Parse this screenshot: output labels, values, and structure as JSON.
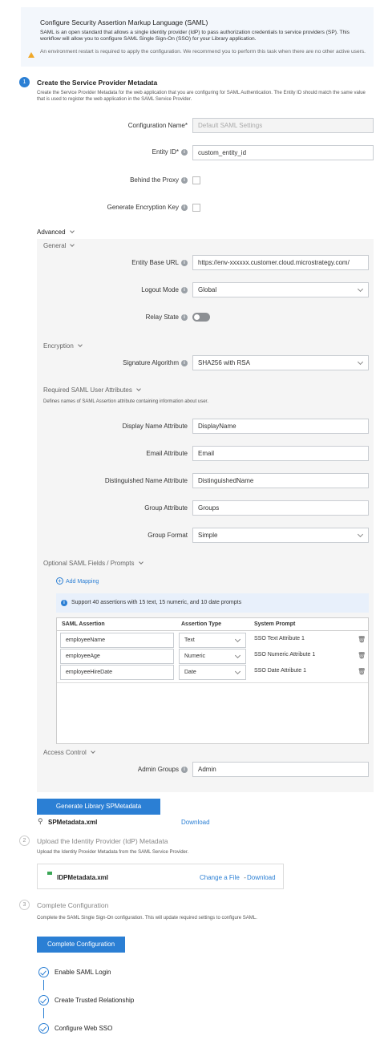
{
  "banner": {
    "title": "Configure Security Assertion Markup Language (SAML)",
    "description": "SAML is an open standard that allows a single identity provider (IdP) to pass authorization credentials to service providers (SP). This workflow will allow you to configure SAML Single Sign-On (SSO) for your Library application.",
    "warning": "An environment restart is required to apply the configuration. We recommend you to perform this task when there are no other active users."
  },
  "step1": {
    "number": "1",
    "title": "Create the Service Provider Metadata",
    "description": "Create the Service Provider Metadata for the web application that you are configuring for SAML Authentication. The Entity ID should match the same value that is used to register the web application in the SAML Service Provider.",
    "config_name": {
      "label": "Configuration Name*",
      "placeholder": "Default SAML Settings"
    },
    "entity_id": {
      "label": "Entity ID*",
      "value": "custom_entity_id"
    },
    "behind_proxy": {
      "label": "Behind the Proxy"
    },
    "gen_enc_key": {
      "label": "Generate Encryption Key"
    },
    "advanced_label": "Advanced",
    "general": {
      "label": "General",
      "entity_base_url": {
        "label": "Entity Base URL",
        "value": "https://env-xxxxxx.customer.cloud.microstrategy.com/"
      },
      "logout_mode": {
        "label": "Logout Mode",
        "value": "Global"
      },
      "relay_state": {
        "label": "Relay State"
      }
    },
    "encryption": {
      "label": "Encryption",
      "signature_algorithm": {
        "label": "Signature Algorithm",
        "value": "SHA256 with RSA"
      }
    },
    "required_attrs": {
      "label": "Required SAML User Attributes",
      "description": "Defines names of SAML Assertion attribute containing information about user.",
      "display_name": {
        "label": "Display Name Attribute",
        "value": "DisplayName"
      },
      "email": {
        "label": "Email Attribute",
        "value": "Email"
      },
      "distinguished_name": {
        "label": "Distinguished Name Attribute",
        "value": "DistinguishedName"
      },
      "group": {
        "label": "Group Attribute",
        "value": "Groups"
      },
      "group_format": {
        "label": "Group Format",
        "value": "Simple"
      }
    },
    "optional": {
      "label": "Optional SAML Fields / Prompts",
      "add_mapping": "Add Mapping",
      "note": "Support 40 assertions with 15 text, 15 numeric, and 10 date prompts",
      "headers": [
        "SAML Assertion",
        "Assertion Type",
        "System Prompt"
      ],
      "rows": [
        {
          "assertion": "employeeName",
          "type": "Text",
          "prompt": "SSO Text Attribute 1"
        },
        {
          "assertion": "employeeAge",
          "type": "Numeric",
          "prompt": "SSO Numeric Attribute 1"
        },
        {
          "assertion": "employeeHireDate",
          "type": "Date",
          "prompt": "SSO Date Attribute 1"
        }
      ]
    },
    "access_control": {
      "label": "Access Control",
      "admin_groups": {
        "label": "Admin Groups",
        "value": "Admin"
      }
    },
    "generate_button": "Generate Library SPMetadata",
    "file_name": "SPMetadata.xml",
    "download": "Download"
  },
  "step2": {
    "number": "2",
    "title": "Upload the Identity Provider (IdP) Metadata",
    "description": "Upload the Identity Provider Metadata from the SAML Service Provider.",
    "file_name": "IDPMetadata.xml",
    "change_file": "Change a File",
    "separator": " - ",
    "download": "Download"
  },
  "step3": {
    "number": "3",
    "title": "Complete Configuration",
    "description": "Complete the SAML Single Sign-On configuration. This will update required settings to configure SAML.",
    "button": "Complete Configuration",
    "checklist": [
      "Enable SAML Login",
      "Create Trusted Relationship",
      "Configure Web SSO"
    ]
  },
  "colors": {
    "accent": "#2b7fd4",
    "warning": "#f0a829",
    "banner_bg": "#f3f7fc",
    "advanced_bg": "#f5f5f5"
  },
  "icons": [
    "warning-icon",
    "info-icon",
    "chevron-down-icon",
    "plus-circle-icon",
    "trash-icon",
    "paperclip-icon",
    "file-icon",
    "check-circle-icon"
  ]
}
